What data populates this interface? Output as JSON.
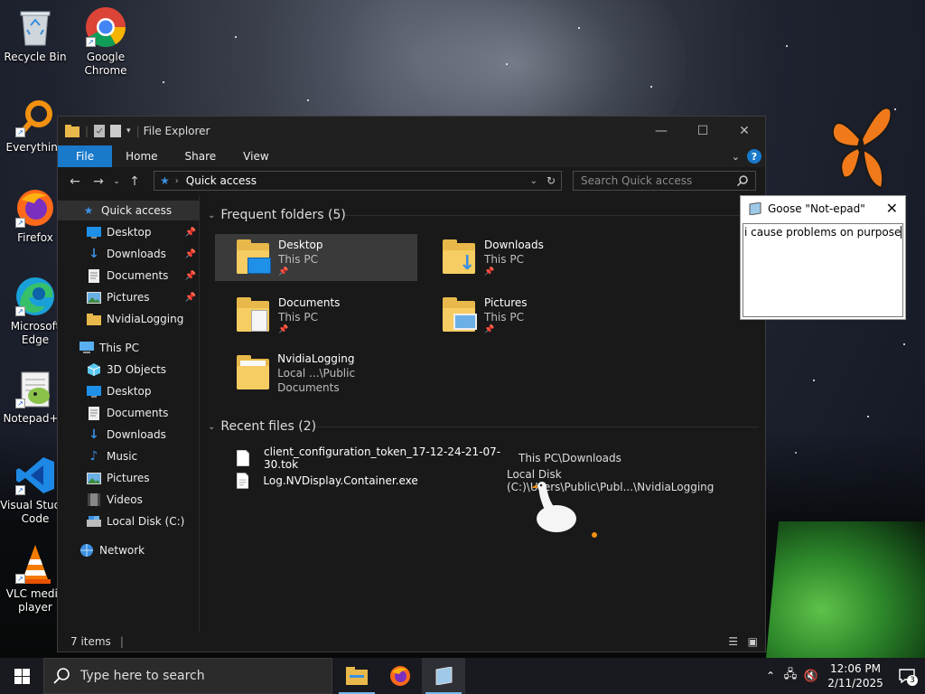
{
  "desktop": {
    "icons": [
      {
        "label": "Recycle Bin",
        "icon": "recycle-bin-icon"
      },
      {
        "label": "Google\nChrome",
        "icon": "chrome-icon"
      },
      {
        "label": "Everything",
        "icon": "everything-icon"
      },
      {
        "label": "Firefox",
        "icon": "firefox-icon"
      },
      {
        "label": "Microsoft\nEdge",
        "icon": "edge-icon"
      },
      {
        "label": "Notepad++",
        "icon": "notepadpp-icon"
      },
      {
        "label": "Visual Studio\nCode",
        "icon": "vscode-icon"
      },
      {
        "label": "VLC media\nplayer",
        "icon": "vlc-icon"
      }
    ]
  },
  "explorer": {
    "title": "File Explorer",
    "ribbon_tabs": [
      "File",
      "Home",
      "Share",
      "View"
    ],
    "address": "Quick access",
    "search_placeholder": "Search Quick access",
    "sidebar": {
      "quick_access": "Quick access",
      "quick_items": [
        "Desktop",
        "Downloads",
        "Documents",
        "Pictures",
        "NvidiaLogging"
      ],
      "this_pc": "This PC",
      "pc_items": [
        "3D Objects",
        "Desktop",
        "Documents",
        "Downloads",
        "Music",
        "Pictures",
        "Videos",
        "Local Disk (C:)"
      ],
      "network": "Network"
    },
    "frequent_header": "Frequent folders (5)",
    "frequent_folders": [
      {
        "name": "Desktop",
        "sub": "This PC"
      },
      {
        "name": "Downloads",
        "sub": "This PC"
      },
      {
        "name": "Documents",
        "sub": "This PC"
      },
      {
        "name": "Pictures",
        "sub": "This PC"
      },
      {
        "name": "NvidiaLogging",
        "sub": "Local ...\\Public Documents"
      }
    ],
    "recent_header": "Recent files (2)",
    "recent_files": [
      {
        "name": "client_configuration_token_17-12-24-21-07-30.tok",
        "location": "This PC\\Downloads"
      },
      {
        "name": "Log.NVDisplay.Container.exe",
        "location": "Local Disk (C:)\\Users\\Public\\Publ...\\NvidiaLogging"
      }
    ],
    "status": "7 items"
  },
  "goose_notepad": {
    "title": "Goose \"Not-epad\"",
    "text": "i cause problems on purpose"
  },
  "taskbar": {
    "search_placeholder": "Type here to search",
    "time": "12:06 PM",
    "date": "2/11/2025",
    "notification_count": "3"
  },
  "colors": {
    "accent": "#1979ca",
    "window_bg": "#191919",
    "folder": "#e8b94a",
    "butterfly": "#f07a1a"
  }
}
